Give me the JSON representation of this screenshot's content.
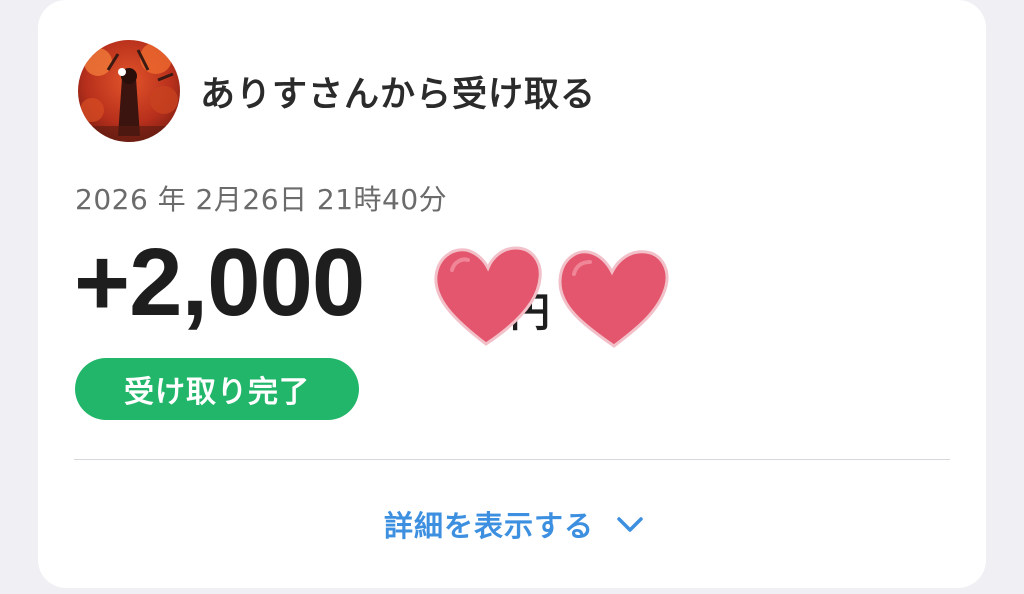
{
  "card": {
    "sender_title": "ありすさんから受け取る",
    "timestamp": "2026 年 2月26日 21時40分",
    "amount": "+2,000",
    "unit": "円",
    "status": "受け取り完了",
    "details_link": "詳細を表示する"
  },
  "icons": {
    "avatar": "avatar-autumn-photo",
    "hearts": "heart-stickers",
    "chevron": "chevron-down-icon"
  },
  "colors": {
    "status_green": "#22b66a",
    "link_blue": "#3d8fe0",
    "heart_pink": "#e4566d"
  }
}
